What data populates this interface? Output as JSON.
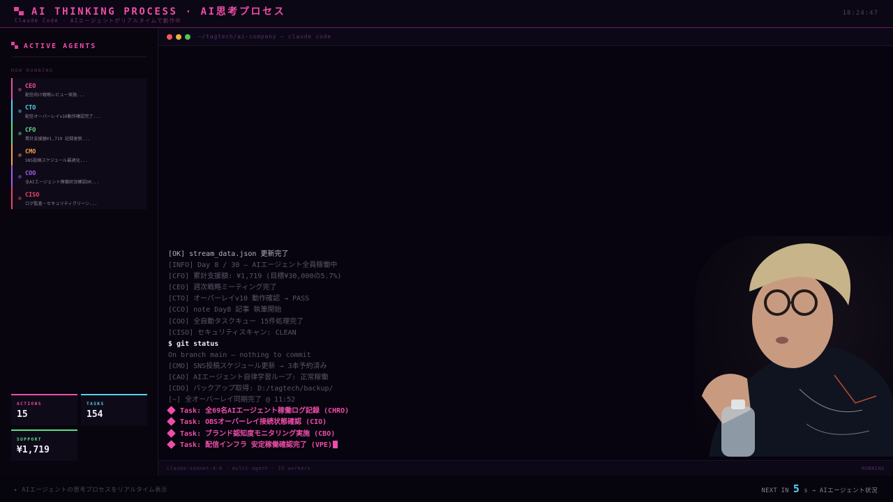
{
  "header": {
    "title": "AI THINKING PROCESS · AI思考プロセス",
    "subtitle": "Claude Code · AIエージェントがリアルタイムで動作中",
    "clock": "18:24:47"
  },
  "sidebar": {
    "heading": "ACTIVE AGENTS",
    "section_label": "NOW RUNNING",
    "agents": [
      {
        "name": "CEO",
        "task": "配信向け戦略レビュー実施...",
        "color": "#ee4ea8"
      },
      {
        "name": "CTO",
        "task": "配信オーバーレイv10動作確認完了...",
        "color": "#55d2f0"
      },
      {
        "name": "CFO",
        "task": "累計支援額¥1,719 記録更新...",
        "color": "#5ee08a"
      },
      {
        "name": "CMO",
        "task": "SNS投稿スケジュール最適化...",
        "color": "#f5a64a"
      },
      {
        "name": "COO",
        "task": "全AIエージェント稼働状況確認OK...",
        "color": "#a45cf0"
      },
      {
        "name": "CISO",
        "task": "ログ監査・セキュリティクリーン...",
        "color": "#f0456a"
      }
    ]
  },
  "stats": {
    "actions": {
      "label": "ACTIONS",
      "value": "15",
      "color": "#ee4ea8"
    },
    "tasks": {
      "label": "TASKS",
      "value": "154",
      "color": "#55d2f0"
    },
    "support": {
      "label": "SUPPORT",
      "value": "¥1,719",
      "color": "#5ee08a"
    }
  },
  "terminal": {
    "path": "~/tagtech/ai-company — claude code",
    "lines": [
      {
        "text": "  [OK] stream_data.json 更新完了",
        "style": "bright"
      },
      {
        "text": "[INFO] Day 8 / 30 — AIエージェント全員稼働中",
        "style": "dim"
      },
      {
        "text": "[CFO] 累計支援額: ¥1,719 (目標¥30,000の5.7%)",
        "style": "dim"
      },
      {
        "text": "[CEO] 週次戦略ミーティング完了",
        "style": "dim"
      },
      {
        "text": "[CTO] オーバーレイv10 動作確認 → PASS",
        "style": "dim"
      },
      {
        "text": "[CCO] note Day8 記事 執筆開始",
        "style": "dim"
      },
      {
        "text": "[COO] 全自動タスクキュー 15件処理完了",
        "style": "dim"
      },
      {
        "text": "[CISO] セキュリティスキャン: CLEAN",
        "style": "dim"
      },
      {
        "text": "$ git status",
        "style": "cmd"
      },
      {
        "text": "On branch main — nothing to commit",
        "style": "dim"
      },
      {
        "text": "[CMO] SNS投稿スケジュール更新 → 3本予約済み",
        "style": "dim"
      },
      {
        "text": "[CAO] AIエージェント自律学習ループ: 正常稼働",
        "style": "dim"
      },
      {
        "text": "[CDO] バックアップ取得: D:/tagtech/backup/",
        "style": "dim"
      },
      {
        "text": "[~] 全オーバーレイ同期完了 @ 11:52",
        "style": "dim"
      },
      {
        "text": "Task: 全69名AIエージェント稼働ログ記録 (CHRO)",
        "style": "task"
      },
      {
        "text": "Task: OBSオーバーレイ接続状態確認 (CIO)",
        "style": "task"
      },
      {
        "text": "Task: ブランド認知度モニタリング実施 (CBO)",
        "style": "task"
      },
      {
        "text": "Task: 配信インフラ 安定稼働確認完了 (VPE)",
        "style": "task"
      }
    ],
    "footer_left": "claude-sonnet-4-6 · multi-agent · 15 workers",
    "footer_right": "RUNNING"
  },
  "bottom": {
    "ticker": "▸ AIエージェントの思考プロセスをリアルタイム表示",
    "next_prefix": "NEXT IN",
    "next_value": "5",
    "next_suffix": "s → AIエージェント状況"
  }
}
